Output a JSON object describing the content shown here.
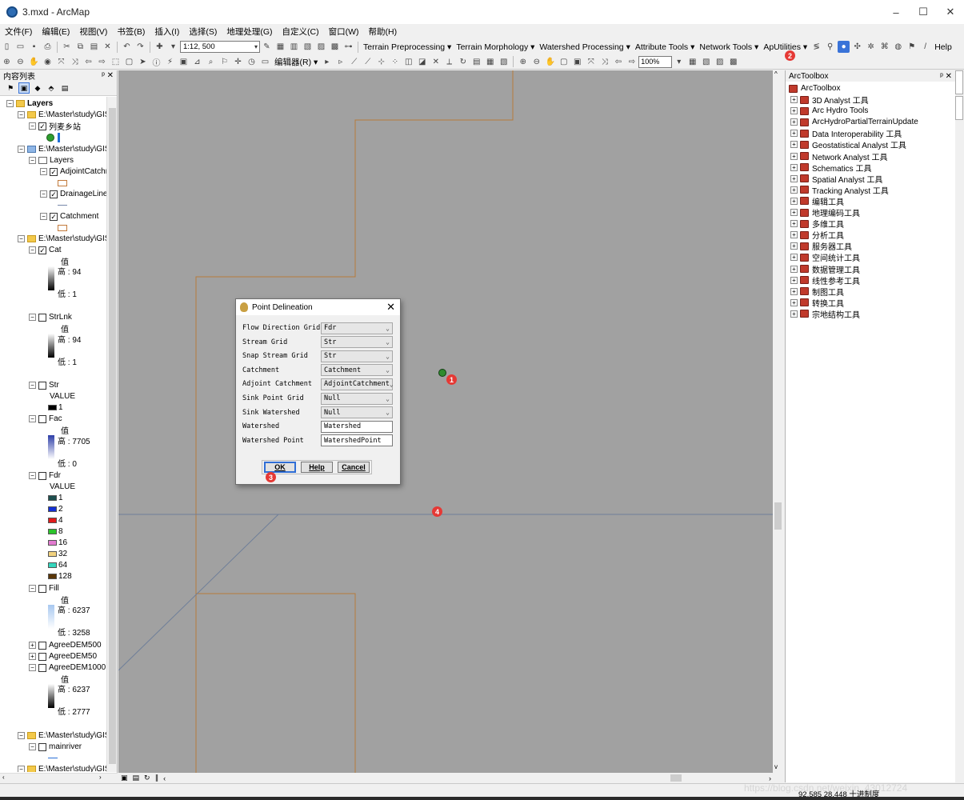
{
  "window": {
    "title": "3.mxd - ArcMap"
  },
  "menu": [
    "文件(F)",
    "编辑(E)",
    "视图(V)",
    "书签(B)",
    "插入(I)",
    "选择(S)",
    "地理处理(G)",
    "自定义(C)",
    "窗口(W)",
    "帮助(H)"
  ],
  "toolbar": {
    "scale": "1:12, 500",
    "menus": [
      "Terrain Preprocessing ▾",
      "Terrain Morphology ▾",
      "Watershed Processing ▾",
      "Attribute Tools ▾",
      "Network Tools ▾",
      "ApUtilities ▾"
    ],
    "help": "Help",
    "editor": "编辑器(R) ▾",
    "zoom": "100%"
  },
  "toc": {
    "title": "内容列表",
    "items": {
      "layers_root": "Layers",
      "path1": "E:\\Master\\study\\GIS",
      "station": "列麦乡站",
      "path2": "E:\\Master\\study\\GIS",
      "layers_sub": "Layers",
      "adjoint": "AdjointCatchn",
      "drainage": "DrainageLine",
      "catchment": "Catchment",
      "path3": "E:\\Master\\study\\GIS",
      "cat": "Cat",
      "strlnk": "StrLnk",
      "str": "Str",
      "fac": "Fac",
      "fdr": "Fdr",
      "fill": "Fill",
      "agree500": "AgreeDEM500",
      "agree50": "AgreeDEM50",
      "agree1000": "AgreeDEM1000",
      "path4": "E:\\Master\\study\\GIS",
      "mainriver": "mainriver",
      "path5": "E:\\Master\\study\\GIS"
    },
    "legend": {
      "val": "值",
      "value": "VALUE",
      "cat_high": "高 : 94",
      "cat_low": "低 : 1",
      "strlnk_high": "高 : 94",
      "strlnk_low": "低 : 1",
      "str_1": "1",
      "fac_high": "高 : 7705",
      "fac_low": "低 : 0",
      "fill_high": "高 : 6237",
      "fill_low": "低 : 3258",
      "agree_high": "高 : 6237",
      "agree_low": "低 : 2777"
    },
    "fdr_classes": [
      {
        "label": "1",
        "color": "#1e4f4f"
      },
      {
        "label": "2",
        "color": "#1431d6"
      },
      {
        "label": "4",
        "color": "#e01b1b"
      },
      {
        "label": "8",
        "color": "#2bc42b"
      },
      {
        "label": "16",
        "color": "#e27bd0"
      },
      {
        "label": "32",
        "color": "#f1d27f"
      },
      {
        "label": "64",
        "color": "#35d6bd"
      },
      {
        "label": "128",
        "color": "#5a3608"
      }
    ]
  },
  "dialog": {
    "title": "Point Delineation",
    "rows": [
      {
        "label": "Flow Direction Grid",
        "value": "Fdr",
        "kind": "select"
      },
      {
        "label": "Stream Grid",
        "value": "Str",
        "kind": "select"
      },
      {
        "label": "Snap Stream Grid",
        "value": "Str",
        "kind": "select"
      },
      {
        "label": "Catchment",
        "value": "Catchment",
        "kind": "select"
      },
      {
        "label": "Adjoint Catchment",
        "value": "AdjointCatchment",
        "kind": "select"
      },
      {
        "label": "Sink Point Grid",
        "value": "Null",
        "kind": "select"
      },
      {
        "label": "Sink Watershed",
        "value": "Null",
        "kind": "select"
      },
      {
        "label": "Watershed",
        "value": "Watershed",
        "kind": "input"
      },
      {
        "label": "Watershed Point",
        "value": "WatershedPoint",
        "kind": "input"
      }
    ],
    "ok": "OK",
    "help": "Help",
    "cancel": "Cancel"
  },
  "badges": [
    "1",
    "2",
    "3",
    "4"
  ],
  "toolbox": {
    "title": "ArcToolbox",
    "root": "ArcToolbox",
    "items": [
      "3D Analyst 工具",
      "Arc Hydro Tools",
      "ArcHydroPartialTerrainUpdate",
      "Data Interoperability 工具",
      "Geostatistical Analyst 工具",
      "Network Analyst 工具",
      "Schematics 工具",
      "Spatial Analyst 工具",
      "Tracking Analyst 工具",
      "编辑工具",
      "地理编码工具",
      "多维工具",
      "分析工具",
      "服务器工具",
      "空间统计工具",
      "数据管理工具",
      "线性参考工具",
      "制图工具",
      "转换工具",
      "宗地结构工具"
    ]
  },
  "status": {
    "coords": "92.585  28.448 十进制度",
    "watermark": "https://blog.csdn.net/weixin_43012724"
  }
}
